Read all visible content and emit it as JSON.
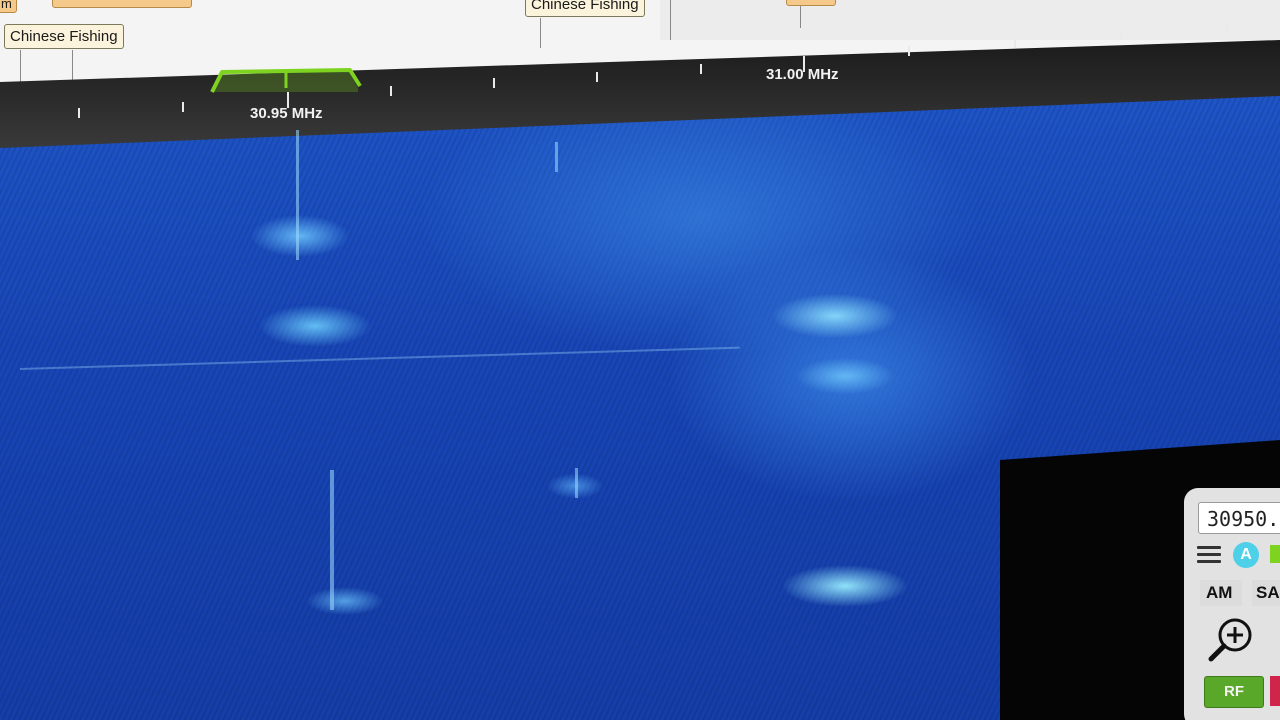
{
  "labels": {
    "left": "Chinese Fishing",
    "center": "Chinese Fishing",
    "orange_top": "m"
  },
  "scale": {
    "freq_left": "30.95 MHz",
    "freq_right": "31.00 MHz"
  },
  "panel": {
    "frequency": "30950.",
    "a_button": "A",
    "mode_am": "AM",
    "mode_sam": "SA",
    "rf_button": "RF"
  },
  "colors": {
    "passband": "#7ed321",
    "waterfall": "#1846b8",
    "rf_button": "#5aa82a",
    "a_button": "#4dd0e8",
    "label_bg": "#fbf3dc"
  },
  "icons": [
    "menu-icon",
    "zoom-in-icon"
  ]
}
